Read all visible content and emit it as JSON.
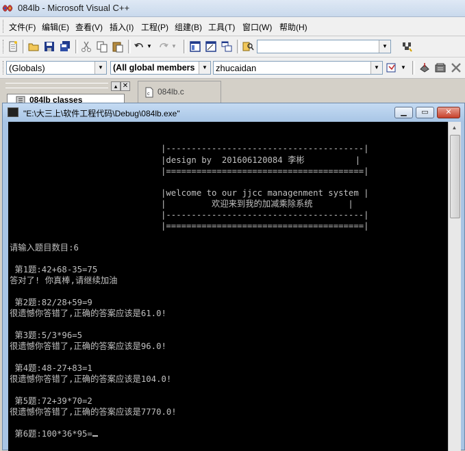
{
  "window": {
    "title": "084lb - Microsoft Visual C++"
  },
  "menu": [
    "文件(F)",
    "编辑(E)",
    "查看(V)",
    "插入(I)",
    "工程(P)",
    "组建(B)",
    "工具(T)",
    "窗口(W)",
    "帮助(H)"
  ],
  "toolbar": {
    "find_value": "",
    "icons": [
      "new-file-icon",
      "open-icon",
      "save-icon",
      "save-all-icon",
      "cut-icon",
      "copy-icon",
      "paste-icon",
      "undo-icon",
      "redo-icon",
      "workspace-icon",
      "output-icon",
      "window-list-icon",
      "find-in-files-icon",
      "find-icon"
    ]
  },
  "wizardbar": {
    "scope": "(Globals)",
    "filter": "(All global members",
    "member": "zhucaidan"
  },
  "workspace": {
    "panel_tab": "084lb classes",
    "doc_tab": "084lb.c"
  },
  "console": {
    "title": "\"E:\\大三上\\软件工程代码\\Debug\\084lb.exe\"",
    "banner": [
      "|---------------------------------------|",
      "|design by  201606120084 李彬          |",
      "|=======================================|",
      "",
      "|welcome to our jjcc managenment system |",
      "|         欢迎来到我的加减乘除系统       |",
      "|---------------------------------------|",
      "|=======================================|"
    ],
    "lines": [
      "请输入题目数目:6",
      "",
      " 第1题:42+68-35=75",
      "答对了! 你真棒,请继续加油",
      "",
      " 第2题:82/28+59=9",
      "很遗憾你答错了,正确的答案应该是61.0!",
      "",
      " 第3题:5/3*96=5",
      "很遗憾你答错了,正确的答案应该是96.0!",
      "",
      " 第4题:48-27+83=1",
      "很遗憾你答错了,正确的答案应该是104.0!",
      "",
      " 第5题:72+39*70=2",
      "很遗憾你答错了,正确的答案应该是7770.0!",
      "",
      " 第6题:100*36*95="
    ]
  }
}
